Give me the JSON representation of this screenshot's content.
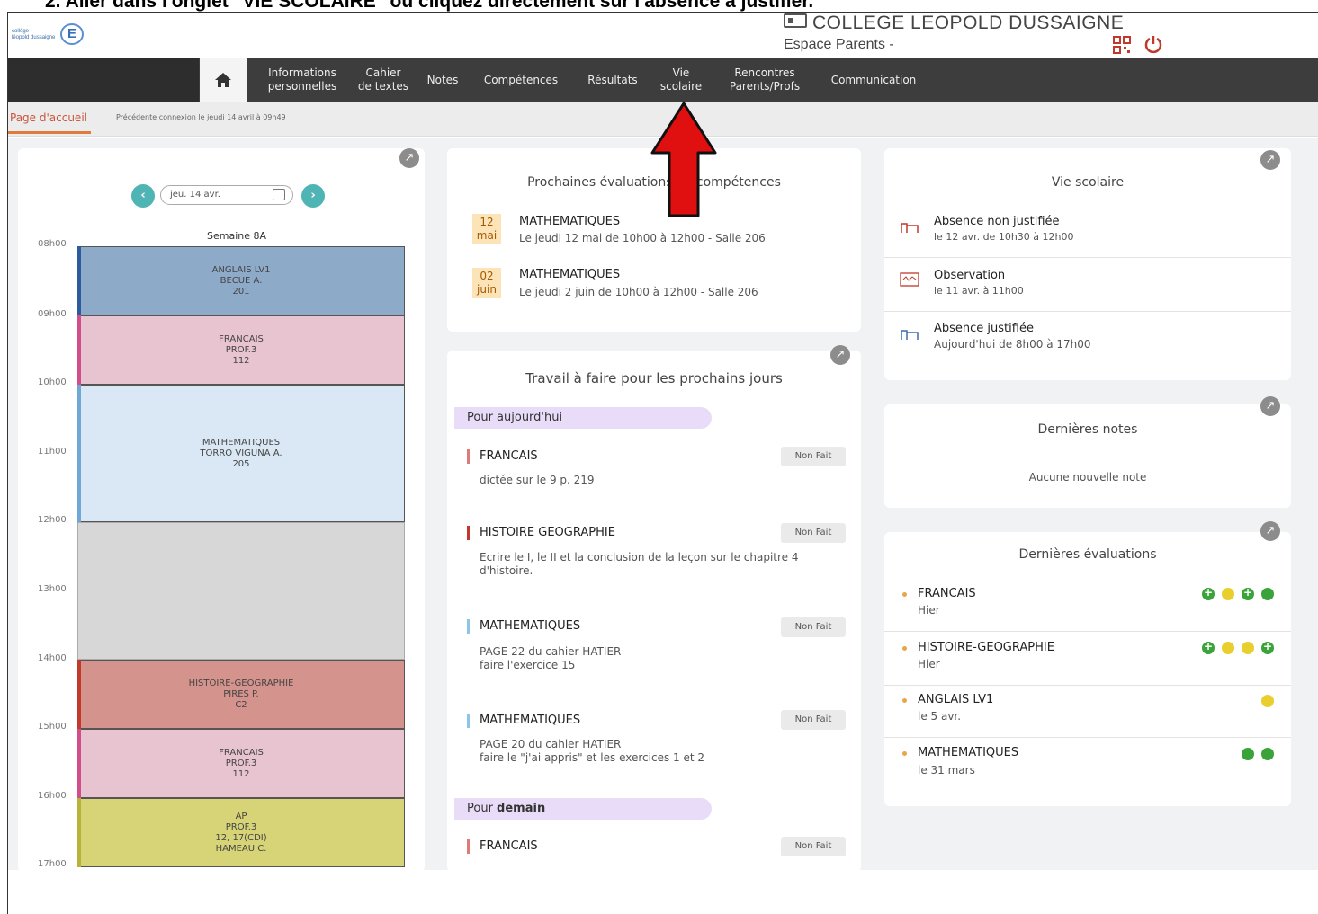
{
  "instruction": "2.   Aller dans l'onglet \"VIE SCOLAIRE\" ou cliquez directement sur l'absence à justifier.",
  "header": {
    "logo_text": "collège\nléopold dussaigne",
    "logo_letter": "E",
    "school_name": "COLLEGE LEOPOLD DUSSAIGNE",
    "space_label": "Espace Parents -"
  },
  "nav": {
    "items": [
      {
        "label": "Informations\npersonnelles"
      },
      {
        "label": "Cahier\nde textes"
      },
      {
        "label": "Notes"
      },
      {
        "label": "Compétences"
      },
      {
        "label": "Résultats"
      },
      {
        "label": "Vie\nscolaire"
      },
      {
        "label": "Rencontres\nParents/Profs"
      },
      {
        "label": "Communication"
      }
    ]
  },
  "breadcrumb": {
    "active": "Page d'accueil",
    "info": "Précédente connexion le jeudi 14 avril à 09h49"
  },
  "agenda": {
    "date": "jeu. 14 avr.",
    "week": "Semaine 8A",
    "hours": [
      "08h00",
      "09h00",
      "10h00",
      "11h00",
      "12h00",
      "13h00",
      "14h00",
      "15h00",
      "16h00",
      "17h00"
    ],
    "slots": [
      {
        "text": "ANGLAIS LV1\nBECUE A.\n201"
      },
      {
        "text": "FRANCAIS\nPROF.3\n112"
      },
      {
        "text": "MATHEMATIQUES\nTORRO VIGUNA A.\n205"
      },
      {
        "text": ""
      },
      {
        "text": "HISTOIRE-GEOGRAPHIE\nPIRES P.\nC2"
      },
      {
        "text": "FRANCAIS\nPROF.3\n112"
      },
      {
        "text": "AP\nPROF.3\n12, 17(CDI)\nHAMEAU C."
      }
    ]
  },
  "evaluations": {
    "title": "Prochaines évaluations de compétences",
    "items": [
      {
        "day": "12",
        "month": "mai",
        "subject": "MATHEMATIQUES",
        "detail": "Le jeudi 12 mai de 10h00 à 12h00  - Salle 206"
      },
      {
        "day": "02",
        "month": "juin",
        "subject": "MATHEMATIQUES",
        "detail": "Le jeudi 2 juin de 10h00 à 12h00  - Salle 206"
      }
    ]
  },
  "homework": {
    "title": "Travail à faire pour les prochains jours",
    "today_label": "Pour aujourd'hui",
    "tomorrow_label": "Pour demain",
    "items": [
      {
        "subject": "FRANCAIS",
        "desc": "dictée sur le 9 p. 219",
        "status": "Non Fait"
      },
      {
        "subject": "HISTOIRE GEOGRAPHIE",
        "desc": "Ecrire le I, le II et la conclusion de la leçon sur le chapitre 4 d'histoire.",
        "status": "Non Fait"
      },
      {
        "subject": "MATHEMATIQUES",
        "desc": "PAGE 22 du cahier HATIER\nfaire l'exercice 15",
        "status": "Non Fait"
      },
      {
        "subject": "MATHEMATIQUES",
        "desc": "PAGE 20 du cahier HATIER\nfaire le \"j'ai appris\" et les exercices 1 et 2",
        "status": "Non Fait"
      },
      {
        "subject": "FRANCAIS",
        "desc": "",
        "status": "Non Fait"
      }
    ]
  },
  "vie_scolaire": {
    "title": "Vie scolaire",
    "items": [
      {
        "title": "Absence non justifiée",
        "detail": "le 12 avr. de 10h30 à 12h00"
      },
      {
        "title": "Observation",
        "detail": "le 11 avr. à 11h00"
      },
      {
        "title": "Absence justifiée",
        "detail": "Aujourd'hui de 8h00 à 17h00"
      }
    ]
  },
  "notes": {
    "title": "Dernières notes",
    "empty": "Aucune nouvelle note"
  },
  "last_evals": {
    "title": "Dernières évaluations",
    "items": [
      {
        "subject": "FRANCAIS",
        "when": "Hier"
      },
      {
        "subject": "HISTOIRE-GEOGRAPHIE",
        "when": "Hier"
      },
      {
        "subject": "ANGLAIS LV1",
        "when": "le 5 avr."
      },
      {
        "subject": "MATHEMATIQUES",
        "when": "le 31 mars"
      }
    ]
  },
  "colors": {
    "accent": "#4eb4b4",
    "nav_bg": "#3d3d3d",
    "arrow": "#e01010",
    "english": "#8eaac9",
    "french": "#e8c3d0",
    "maths": "#d9e8f4",
    "empty": "#d7d7d7",
    "history": "#d4938c",
    "ap": "#d6d477"
  }
}
